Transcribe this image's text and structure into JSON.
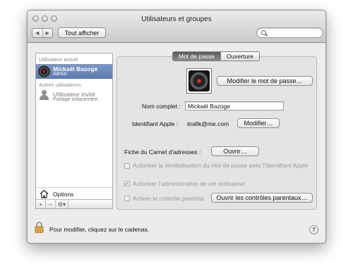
{
  "window": {
    "title": "Utilisateurs et groupes"
  },
  "toolbar": {
    "show_all_label": "Tout afficher",
    "back_glyph": "◀",
    "forward_glyph": "▶",
    "search_placeholder": ""
  },
  "sidebar": {
    "current_user_header": "Utilisateur actuel",
    "current_user": {
      "name": "Mickaël Bazoge",
      "role": "Admin"
    },
    "other_users_header": "Autres utilisateurs",
    "guest_user": {
      "name": "Utilisateur invité",
      "role": "Partage uniquement"
    },
    "options_label": "Options",
    "bottom_buttons": [
      "+",
      "−",
      "⚙▾"
    ]
  },
  "tabs": [
    {
      "label": "Mot de passe",
      "active": true
    },
    {
      "label": "Ouverture",
      "active": false
    }
  ],
  "password_panel": {
    "change_password_button": "Modifier le mot de passe…",
    "full_name_label": "Nom complet :",
    "full_name_value": "Mickaël Bazoge",
    "apple_id_label": "Identifiant Apple :",
    "apple_id_value": "itrafik@me.com",
    "apple_id_modify_button": "Modifier…",
    "address_book_label": "Fiche du Carnet d'adresses :",
    "address_book_open_button": "Ouvrir…",
    "allow_reset_label": "Autoriser la réinitialisation du mot de passe avec l'identifiant Apple",
    "allow_admin_label": "Autoriser l'administration de cet ordinateur",
    "parental_controls_label": "Activer le contrôle parental",
    "parental_controls_button": "Ouvrir les contrôles parentaux…"
  },
  "footer": {
    "lock_text": "Pour modifier, cliquez sur le cadenas.",
    "help_glyph": "?"
  },
  "colors": {
    "selection": "#5a7ab0",
    "window_bg": "#ececec",
    "lock_gold": "#d9a53a"
  }
}
